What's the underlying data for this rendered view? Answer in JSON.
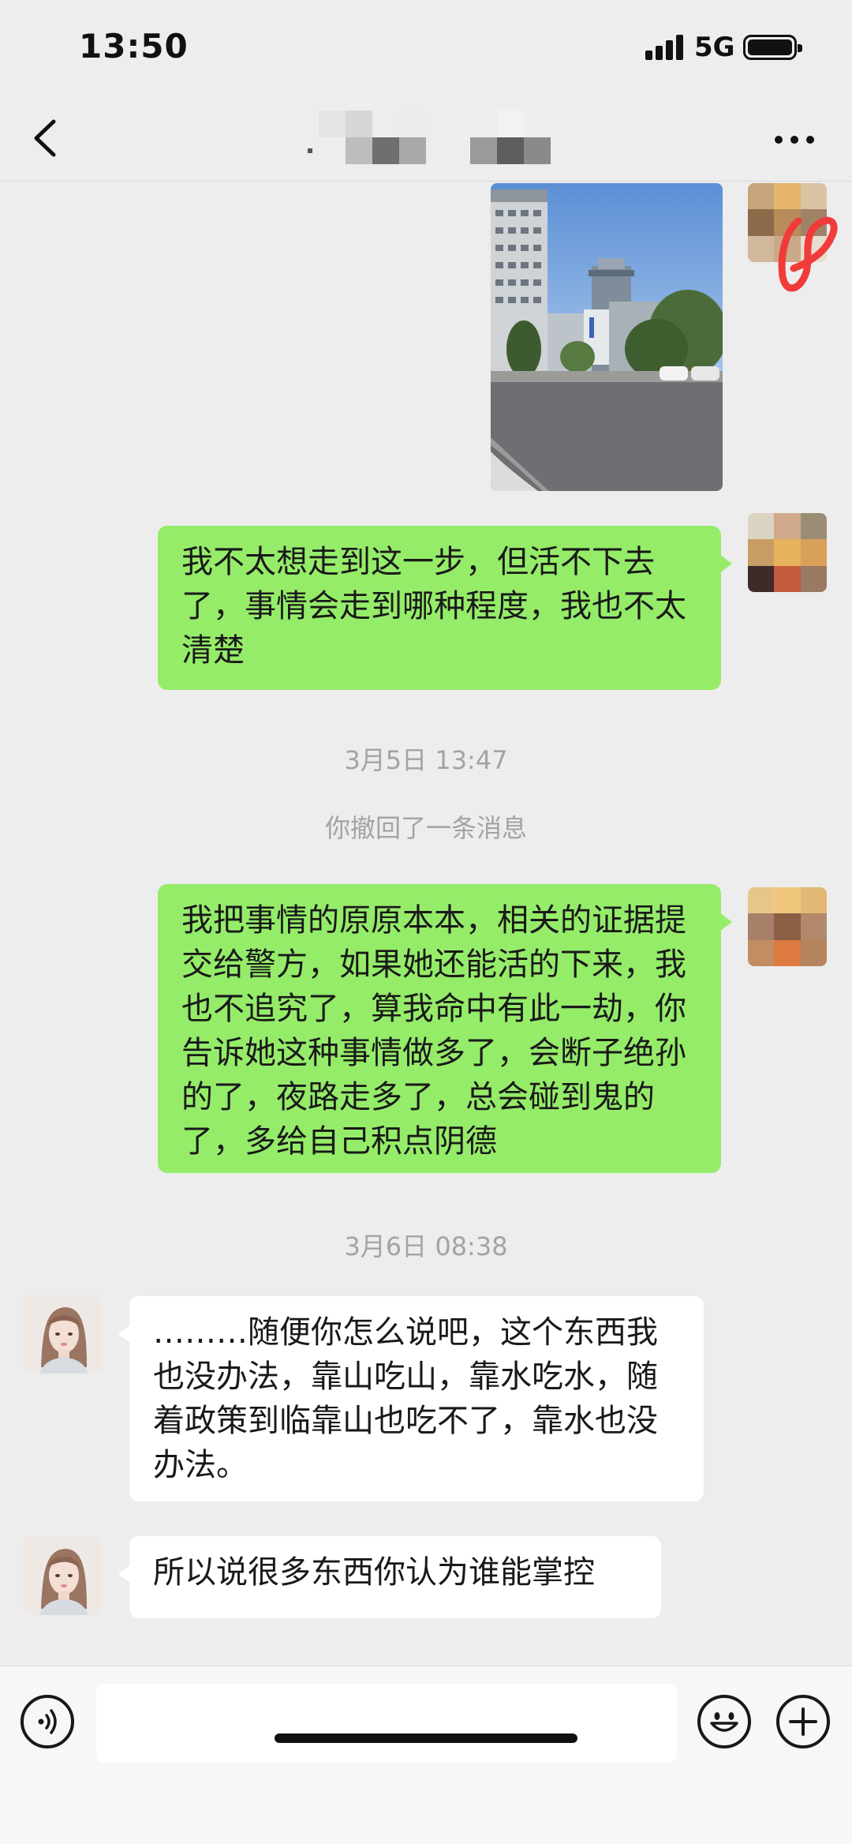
{
  "status_bar": {
    "time": "13:50",
    "network": "5G"
  },
  "header": {
    "title": ""
  },
  "messages": [
    {
      "side": "me",
      "type": "image"
    },
    {
      "side": "me",
      "text": "我不太想走到这一步，但活不下去了，事情会走到哪种程度，我也不太清楚"
    },
    {
      "type": "timestamp",
      "text": "3月5日 13:47"
    },
    {
      "type": "system",
      "text": "你撤回了一条消息"
    },
    {
      "side": "me",
      "text": "我把事情的原原本本，相关的证据提交给警方，如果她还能活的下来，我也不追究了，算我命中有此一劫，你告诉她这种事情做多了，会断子绝孙的了，夜路走多了，总会碰到鬼的了，多给自己积点阴德"
    },
    {
      "type": "timestamp",
      "text": "3月6日 08:38"
    },
    {
      "side": "them",
      "text": "………随便你怎么说吧，这个东西我也没办法，靠山吃山，靠水吃水，随着政策到临靠山也吃不了，靠水也没办法。"
    },
    {
      "side": "them",
      "text": "所以说很多东西你认为谁能掌控"
    }
  ],
  "icons": {
    "back": "chevron-left-icon",
    "more": "more-dots-icon",
    "voice": "voice-icon",
    "emoji": "emoji-icon",
    "add": "plus-icon"
  },
  "colors": {
    "my_bubble": "#95ec69",
    "their_bubble": "#ffffff",
    "background": "#ededed",
    "timestamp": "#a3a3a3"
  }
}
